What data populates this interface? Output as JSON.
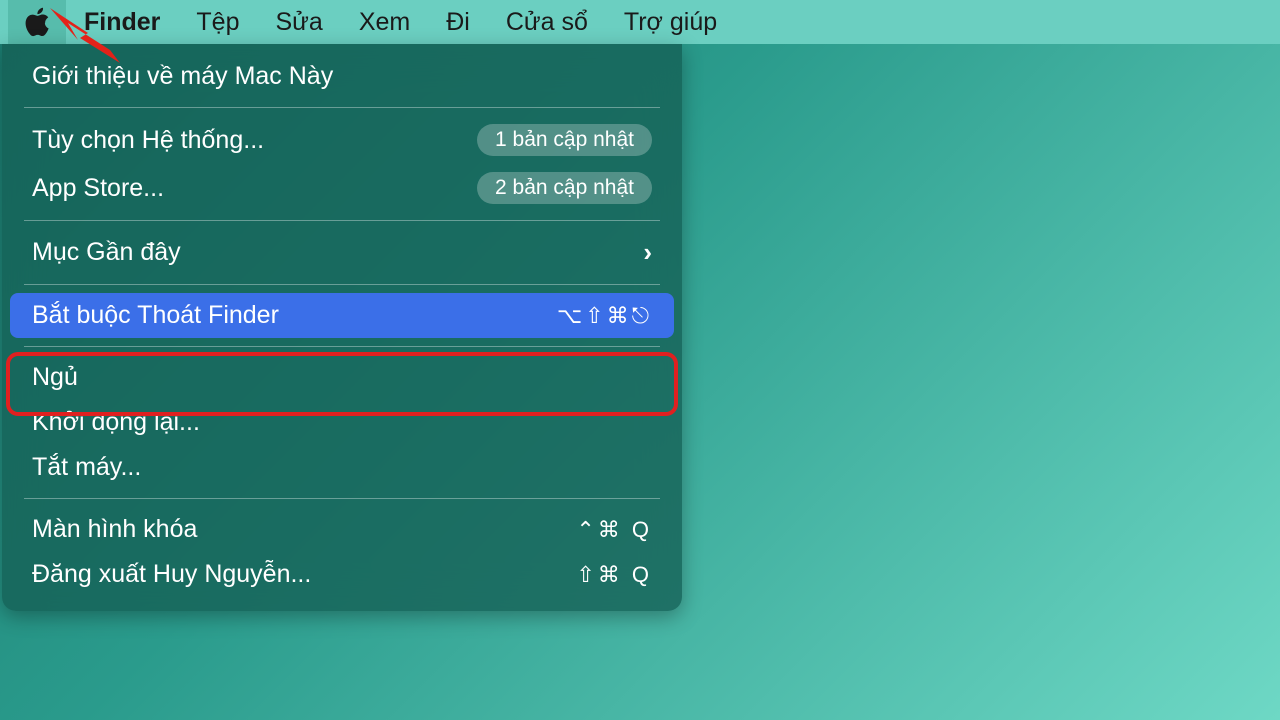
{
  "menubar": {
    "appname": "Finder",
    "items": [
      "Tệp",
      "Sửa",
      "Xem",
      "Đi",
      "Cửa sổ",
      "Trợ giúp"
    ]
  },
  "dropdown": {
    "about": "Giới thiệu về máy Mac Này",
    "system_settings": {
      "label": "Tùy chọn Hệ thống...",
      "badge": "1 bản cập nhật"
    },
    "app_store": {
      "label": "App Store...",
      "badge": "2 bản cập nhật"
    },
    "recent": "Mục Gần đây",
    "force_quit": {
      "label": "Bắt buộc Thoát Finder",
      "shortcut": "⌥⇧⌘⎋"
    },
    "sleep": "Ngủ",
    "restart": "Khởi động lại...",
    "shutdown": "Tắt máy...",
    "lock": {
      "label": "Màn hình khóa",
      "shortcut": "⌃⌘ Q"
    },
    "logout": {
      "label": "Đăng xuất Huy Nguyễn...",
      "shortcut": "⇧⌘ Q"
    }
  }
}
